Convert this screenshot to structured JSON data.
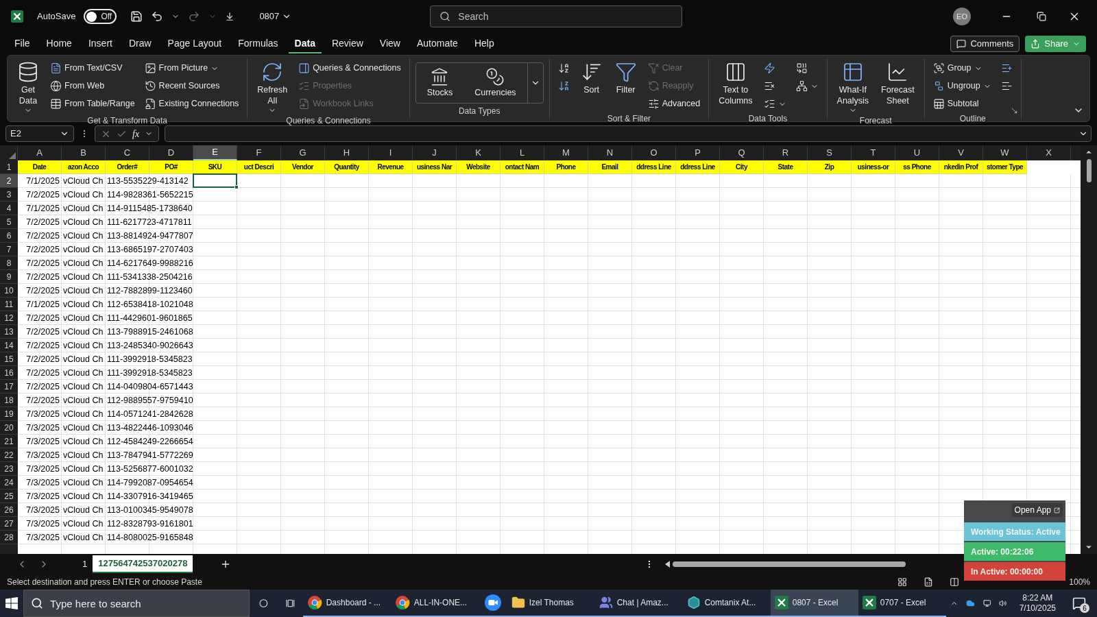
{
  "title_bar": {
    "autosave_label": "AutoSave",
    "autosave_on": false,
    "autosave_state": "Off",
    "redo_disabled": true,
    "file_name": "0807",
    "search_placeholder": "Search",
    "avatar": "EO"
  },
  "menu_tabs": [
    {
      "label": "File",
      "selected": false
    },
    {
      "label": "Home",
      "selected": false
    },
    {
      "label": "Insert",
      "selected": false
    },
    {
      "label": "Draw",
      "selected": false
    },
    {
      "label": "Page Layout",
      "selected": false
    },
    {
      "label": "Formulas",
      "selected": false
    },
    {
      "label": "Data",
      "selected": true
    },
    {
      "label": "Review",
      "selected": false
    },
    {
      "label": "View",
      "selected": false
    },
    {
      "label": "Automate",
      "selected": false
    },
    {
      "label": "Help",
      "selected": false
    }
  ],
  "comments_button": "Comments",
  "share_button": "Share",
  "ribbon": [
    {
      "kind": "get_transform",
      "label": "Get & Transform Data",
      "launcher": false,
      "items": [
        {
          "kind": "large",
          "lines": [
            "Get",
            "Data"
          ],
          "dropdown": true
        },
        {
          "kind": "column",
          "buttons": [
            {
              "label": "From Text/CSV",
              "disabled": false,
              "dropdown": false
            },
            {
              "label": "From Web",
              "disabled": false,
              "dropdown": false
            },
            {
              "label": "From Table/Range",
              "disabled": false,
              "dropdown": false
            }
          ]
        },
        {
          "kind": "column",
          "buttons": [
            {
              "label": "From Picture",
              "disabled": false,
              "dropdown": true
            },
            {
              "label": "Recent Sources",
              "disabled": false,
              "dropdown": false
            },
            {
              "label": "Existing Connections",
              "disabled": false,
              "dropdown": false
            }
          ]
        }
      ]
    },
    {
      "kind": "queries",
      "label": "Queries & Connections",
      "launcher": false,
      "items": [
        {
          "kind": "large",
          "lines": [
            "Refresh",
            "All"
          ],
          "dropdown": true
        },
        {
          "kind": "column",
          "buttons": [
            {
              "label": "Queries & Connections",
              "disabled": false,
              "dropdown": false
            },
            {
              "label": "Properties",
              "disabled": true,
              "dropdown": false
            },
            {
              "label": "Workbook Links",
              "disabled": true,
              "dropdown": false
            }
          ]
        }
      ]
    },
    {
      "kind": "data_types",
      "label": "Data Types",
      "launcher": false,
      "items": [
        {
          "kind": "gallery",
          "expandable": true,
          "buttons": [
            {
              "label": "Stocks"
            },
            {
              "label": "Currencies"
            }
          ]
        }
      ]
    },
    {
      "kind": "sort_filter",
      "label": "Sort & Filter",
      "launcher": false,
      "items": [
        {
          "kind": "column",
          "buttons": [
            {
              "disabled": false,
              "dropdown": false
            },
            {
              "disabled": false,
              "dropdown": false
            }
          ]
        },
        {
          "kind": "large",
          "lines": [
            "Sort"
          ],
          "dropdown": false
        },
        {
          "kind": "large",
          "lines": [
            "Filter"
          ],
          "dropdown": false
        },
        {
          "kind": "column",
          "buttons": [
            {
              "label": "Clear",
              "disabled": true,
              "dropdown": false
            },
            {
              "label": "Reapply",
              "disabled": true,
              "dropdown": false
            },
            {
              "label": "Advanced",
              "disabled": false,
              "dropdown": false
            }
          ]
        }
      ]
    },
    {
      "kind": "data_tools",
      "label": "Data Tools",
      "launcher": false,
      "items": [
        {
          "kind": "large",
          "lines": [
            "Text to",
            "Columns"
          ],
          "dropdown": false
        },
        {
          "kind": "column",
          "buttons": [
            {
              "disabled": false,
              "dropdown": false
            },
            {
              "disabled": false,
              "dropdown": false
            },
            {
              "disabled": false,
              "dropdown": true
            }
          ]
        },
        {
          "kind": "column",
          "buttons": [
            {
              "disabled": false,
              "dropdown": false
            },
            {
              "disabled": false,
              "dropdown": true
            }
          ]
        }
      ]
    },
    {
      "kind": "forecast",
      "label": "Forecast",
      "launcher": false,
      "items": [
        {
          "kind": "large",
          "lines": [
            "What-If",
            "Analysis"
          ],
          "dropdown": true
        },
        {
          "kind": "large",
          "lines": [
            "Forecast",
            "Sheet"
          ],
          "dropdown": false
        }
      ]
    },
    {
      "kind": "outline",
      "label": "Outline",
      "launcher": true,
      "items": [
        {
          "kind": "column",
          "buttons": [
            {
              "label": "Group",
              "disabled": false,
              "dropdown": true
            },
            {
              "label": "Ungroup",
              "disabled": false,
              "dropdown": true
            },
            {
              "label": "Subtotal",
              "disabled": false,
              "dropdown": false
            }
          ]
        },
        {
          "kind": "column",
          "buttons": [
            {
              "disabled": false,
              "dropdown": false
            },
            {
              "disabled": false,
              "dropdown": false
            }
          ]
        }
      ]
    }
  ],
  "formula_bar": {
    "name_box": "E2",
    "function_label": "fx"
  },
  "columns": [
    {
      "letter": "A",
      "selected": false
    },
    {
      "letter": "B",
      "selected": false
    },
    {
      "letter": "C",
      "selected": false
    },
    {
      "letter": "D",
      "selected": false
    },
    {
      "letter": "E",
      "selected": true
    },
    {
      "letter": "F",
      "selected": false
    },
    {
      "letter": "G",
      "selected": false
    },
    {
      "letter": "H",
      "selected": false
    },
    {
      "letter": "I",
      "selected": false
    },
    {
      "letter": "J",
      "selected": false
    },
    {
      "letter": "K",
      "selected": false
    },
    {
      "letter": "L",
      "selected": false
    },
    {
      "letter": "M",
      "selected": false
    },
    {
      "letter": "N",
      "selected": false
    },
    {
      "letter": "O",
      "selected": false
    },
    {
      "letter": "P",
      "selected": false
    },
    {
      "letter": "Q",
      "selected": false
    },
    {
      "letter": "R",
      "selected": false
    },
    {
      "letter": "S",
      "selected": false
    },
    {
      "letter": "T",
      "selected": false
    },
    {
      "letter": "U",
      "selected": false
    },
    {
      "letter": "V",
      "selected": false
    },
    {
      "letter": "W",
      "selected": false
    },
    {
      "letter": "X",
      "selected": false
    }
  ],
  "header_row": {
    "number": "1",
    "cells": [
      "Date",
      "azon Acco",
      "Order#",
      "PO#",
      "SKU",
      "uct Descri",
      "Vendor",
      "Quantity",
      "Revenue",
      "usiness Nar",
      "Website",
      "ontact Nam",
      "Phone",
      "Email",
      "ddress Line",
      "ddress Line",
      "City",
      "State",
      "Zip",
      "usiness-or",
      "ss Phone",
      "nkedin Prof",
      "stomer Type"
    ]
  },
  "rows": [
    {
      "number": "2",
      "selected": true,
      "cells": [
        "7/1/2025",
        "vCloud Ch",
        "113-5535229-413142"
      ]
    },
    {
      "number": "3",
      "selected": false,
      "cells": [
        "7/2/2025",
        "vCloud Ch",
        "114-9828361-5652215"
      ]
    },
    {
      "number": "4",
      "selected": false,
      "cells": [
        "7/1/2025",
        "vCloud Ch",
        "114-9115485-1738640"
      ]
    },
    {
      "number": "5",
      "selected": false,
      "cells": [
        "7/2/2025",
        "vCloud Ch",
        "111-6217723-4717811"
      ]
    },
    {
      "number": "6",
      "selected": false,
      "cells": [
        "7/2/2025",
        "vCloud Ch",
        "113-8814924-9477807"
      ]
    },
    {
      "number": "7",
      "selected": false,
      "cells": [
        "7/2/2025",
        "vCloud Ch",
        "113-6865197-2707403"
      ]
    },
    {
      "number": "8",
      "selected": false,
      "cells": [
        "7/2/2025",
        "vCloud Ch",
        "114-6217649-9988216"
      ]
    },
    {
      "number": "9",
      "selected": false,
      "cells": [
        "7/2/2025",
        "vCloud Ch",
        "111-5341338-2504216"
      ]
    },
    {
      "number": "10",
      "selected": false,
      "cells": [
        "7/2/2025",
        "vCloud Ch",
        "112-7882899-1123460"
      ]
    },
    {
      "number": "11",
      "selected": false,
      "cells": [
        "7/1/2025",
        "vCloud Ch",
        "112-6538418-1021048"
      ]
    },
    {
      "number": "12",
      "selected": false,
      "cells": [
        "7/2/2025",
        "vCloud Ch",
        "111-4429601-9601865"
      ]
    },
    {
      "number": "13",
      "selected": false,
      "cells": [
        "7/2/2025",
        "vCloud Ch",
        "113-7988915-2461068"
      ]
    },
    {
      "number": "14",
      "selected": false,
      "cells": [
        "7/2/2025",
        "vCloud Ch",
        "113-2485340-9026643"
      ]
    },
    {
      "number": "15",
      "selected": false,
      "cells": [
        "7/2/2025",
        "vCloud Ch",
        "111-3992918-5345823"
      ]
    },
    {
      "number": "16",
      "selected": false,
      "cells": [
        "7/2/2025",
        "vCloud Ch",
        "111-3992918-5345823"
      ]
    },
    {
      "number": "17",
      "selected": false,
      "cells": [
        "7/2/2025",
        "vCloud Ch",
        "114-0409804-6571443"
      ]
    },
    {
      "number": "18",
      "selected": false,
      "cells": [
        "7/2/2025",
        "vCloud Ch",
        "112-9889557-9759410"
      ]
    },
    {
      "number": "19",
      "selected": false,
      "cells": [
        "7/3/2025",
        "vCloud Ch",
        "114-0571241-2842628"
      ]
    },
    {
      "number": "20",
      "selected": false,
      "cells": [
        "7/3/2025",
        "vCloud Ch",
        "113-4822446-1093046"
      ]
    },
    {
      "number": "21",
      "selected": false,
      "cells": [
        "7/3/2025",
        "vCloud Ch",
        "112-4584249-2266654"
      ]
    },
    {
      "number": "22",
      "selected": false,
      "cells": [
        "7/3/2025",
        "vCloud Ch",
        "113-7847941-5772269"
      ]
    },
    {
      "number": "23",
      "selected": false,
      "cells": [
        "7/3/2025",
        "vCloud Ch",
        "113-5256877-6001032"
      ]
    },
    {
      "number": "24",
      "selected": false,
      "cells": [
        "7/3/2025",
        "vCloud Ch",
        "114-7992087-0954654"
      ]
    },
    {
      "number": "25",
      "selected": false,
      "cells": [
        "7/3/2025",
        "vCloud Ch",
        "114-3307916-3419465"
      ]
    },
    {
      "number": "26",
      "selected": false,
      "cells": [
        "7/3/2025",
        "vCloud Ch",
        "113-0100345-9549078"
      ]
    },
    {
      "number": "27",
      "selected": false,
      "cells": [
        "7/3/2025",
        "vCloud Ch",
        "112-8328793-9161801"
      ]
    },
    {
      "number": "28",
      "selected": false,
      "cells": [
        "7/3/2025",
        "vCloud Ch",
        "114-8080025-9165848"
      ]
    }
  ],
  "sheet_tabs": [
    {
      "label": "1",
      "selected": false
    },
    {
      "label": "127564742537020278",
      "selected": true
    }
  ],
  "status_bar": {
    "message": "Select destination and press ENTER or choose Paste",
    "zoom": "100%"
  },
  "tracker": {
    "open_app": "Open App",
    "statuses": [
      {
        "label": "Working Status: Active",
        "color": "#6cc3d5"
      },
      {
        "label": "Active: 00:22:06",
        "color": "#3dbb6a"
      },
      {
        "label": "In Active: 00:00:00",
        "color": "#d4433a"
      }
    ]
  },
  "taskbar": {
    "search_placeholder": "Type here to search",
    "apps": [
      {
        "label": "Dashboard - ...",
        "selected": false
      },
      {
        "label": "ALL-IN-ONE...",
        "selected": false
      },
      {
        "selected": false
      },
      {
        "label": "Izel Thomas",
        "selected": false
      },
      {
        "label": "Chat | Amaz...",
        "selected": false
      },
      {
        "label": "Comtanix At...",
        "selected": false
      },
      {
        "label": "0807 - Excel",
        "selected": true
      },
      {
        "label": "0707 - Excel",
        "selected": false
      }
    ],
    "time": "8:22 AM",
    "date": "7/10/2025",
    "notifications": "6"
  }
}
